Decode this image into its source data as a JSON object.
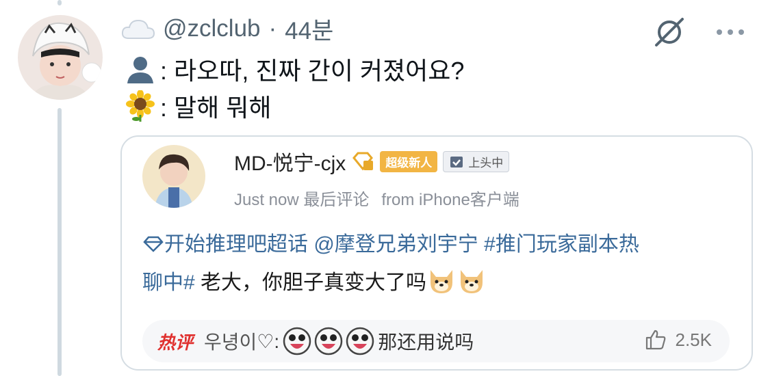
{
  "post": {
    "username": "@zclclub",
    "separator": "·",
    "time": "44분",
    "line1": ": 라오따, 진짜 간이 커졌어요?",
    "line2": ": 말해 뭐해"
  },
  "icons": {
    "header_icon": "cloud-icon",
    "line1_icon": "person-silhouette-icon",
    "line2_icon": "sunflower-icon",
    "grok": "slash-circle-icon",
    "more": "more-horizontal-icon"
  },
  "card": {
    "name": "MD-悦宁-cjx",
    "badge_new": "超级新人",
    "badge_top": "上头中",
    "time": "Just now 最后评论",
    "source": "from iPhone客户端",
    "body_tag1": "开始推理吧超话",
    "body_mention": "@摩登兄弟刘宇宁",
    "body_tag2_a": "#推门玩家副本热",
    "body_tag2_b": "聊中#",
    "body_text": " 老大，你胆子真变大了吗",
    "hot_label": "热评",
    "hot_user": "우녕이",
    "hot_heart": "♡:",
    "hot_text": "那还用说吗",
    "likes": "2.5K"
  },
  "colors": {
    "secondary_text": "#536471",
    "link": "#3a6a9a",
    "hot": "#e0312f",
    "badge_new": "#f2b544",
    "thread_line": "#cfd9e0"
  }
}
